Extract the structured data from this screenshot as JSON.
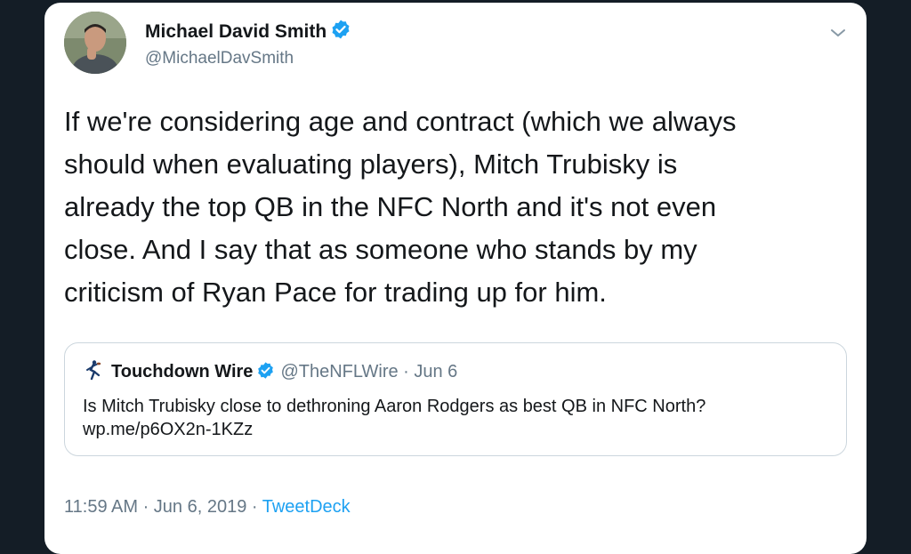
{
  "author": {
    "name": "Michael David Smith",
    "handle": "@MichaelDavSmith"
  },
  "tweet": {
    "text": "If we're considering age and contract (which we always\nshould when evaluating players), Mitch Trubisky is\nalready the top QB in the NFC North and it's not even\nclose. And I say that as someone who stands by my\ncriticism of Ryan Pace for trading up for him."
  },
  "quoted_tweet": {
    "name": "Touchdown Wire",
    "handle_date": "@TheNFLWire · Jun 6",
    "text": "Is Mitch Trubisky close to dethroning Aaron Rodgers as best QB in NFC North?\nwp.me/p6OX2n-1KZz"
  },
  "meta": {
    "timestamp": "11:59 AM · Jun 6, 2019 · ",
    "source": "TweetDeck"
  },
  "colors": {
    "accent": "#1da1f2",
    "background": "#141d26",
    "card": "#ffffff"
  }
}
